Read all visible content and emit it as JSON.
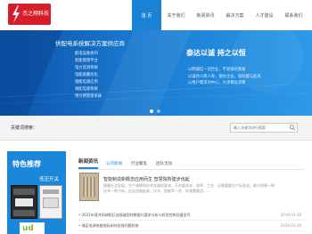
{
  "header": {
    "logo_text": "杰之翔科技",
    "nav": [
      "首 页",
      "关于我们",
      "新闻资讯",
      "解决方案",
      "人才建设",
      "联系我们"
    ]
  },
  "banner": {
    "title": "供配电系统解决方案供应商",
    "items": [
      "配电设备系列",
      "智能管理平台",
      "电力监测系统",
      "电能质量优化",
      "储能电源应用",
      "调配电源系统",
      "预付费管理系统"
    ],
    "slogan": "泰达以诚  持之以恒",
    "sub": [
      "以明诚信一切世业，不退速达真速",
      "以诚待人修人卑，德达企业，如同能与此风",
      "以用户需求为中心，力求精益求精"
    ]
  },
  "search": {
    "label": "关键词搜索：",
    "placeholder": "输入关键字进行搜索"
  },
  "feature": {
    "title": "特色推荐",
    "subtitle": "低压开关",
    "logo_text": "ud"
  },
  "news": {
    "title": "新闻资讯",
    "tabs": [
      "公司新闻",
      "行业聚焦",
      "团队活动"
    ],
    "featured": {
      "headline": "智能制造新概念应用而生  智慧院所建步伐起",
      "desc": [
        "随着社会发展，生产规模和技术含量的要求，不仅要成本、效率、工艺、还需要能生产标准化。能分如果一种",
        "技术一种方向，在这里做起来，技术，智能等一步，你我需要迎……"
      ]
    },
    "list": [
      {
        "title": "• 2021年直并网调相压连接器型材数据与要求分析与检验控制设备型号",
        "date": "2019-03-26"
      },
      {
        "title": "• 城区电源电能指标如何处理问题检修",
        "date": "2019-03-26"
      }
    ]
  }
}
